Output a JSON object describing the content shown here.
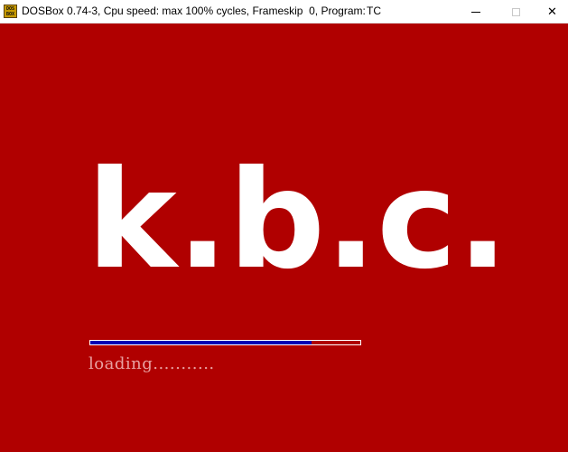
{
  "window": {
    "title": "DOSBox 0.74-3, Cpu speed: max 100% cycles, Frameskip  0, Program:",
    "program": "TC",
    "app_icon": "dosbox-icon",
    "app_icon_text": "DOS BOX",
    "controls": {
      "minimize_icon": "minimize-icon",
      "maximize_icon": "maximize-icon",
      "close_icon": "close-icon",
      "close_glyph": "✕"
    }
  },
  "screen": {
    "background_color": "#b00000",
    "title_text": "k.b.c.",
    "progress": {
      "fraction": 0.82,
      "fill_color": "#0000b4",
      "track_border_color": "#ffffff"
    },
    "loading_text": "loading..........."
  }
}
